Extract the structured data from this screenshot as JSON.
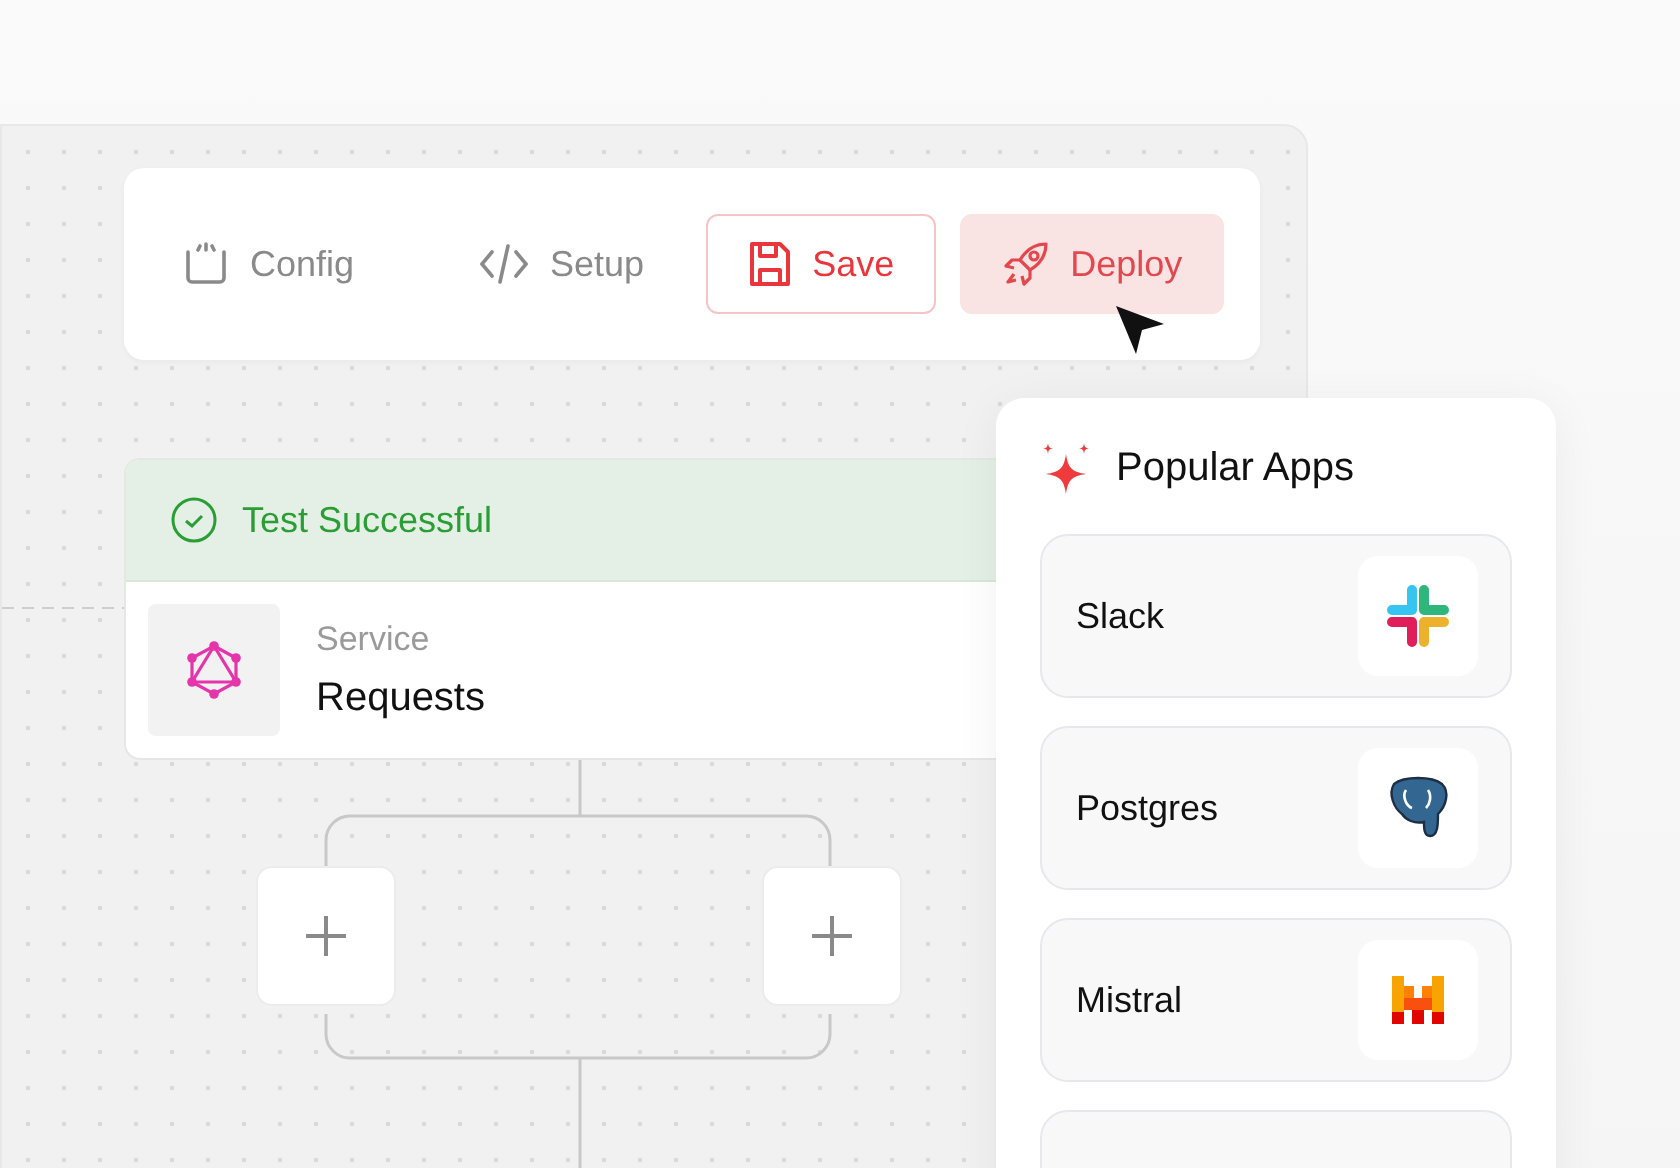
{
  "toolbar": {
    "items": [
      {
        "kind": "plain",
        "label": "Config"
      },
      {
        "kind": "plain",
        "label": "Setup"
      },
      {
        "kind": "outline",
        "label": "Save"
      },
      {
        "kind": "filled",
        "label": "Deploy"
      }
    ]
  },
  "node": {
    "status": "Test Successful",
    "type": "Service",
    "name": "Requests"
  },
  "popular_apps": {
    "title": "Popular Apps",
    "apps": [
      {
        "name": "Slack"
      },
      {
        "name": "Postgres"
      },
      {
        "name": "Mistral"
      }
    ]
  }
}
